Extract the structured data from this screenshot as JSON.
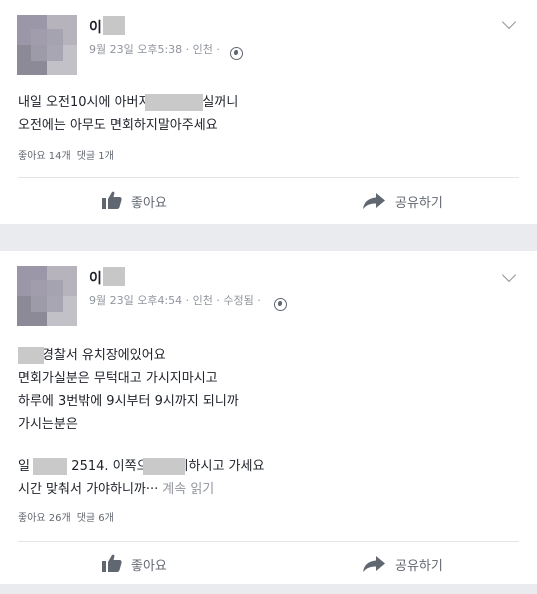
{
  "posts": [
    {
      "author_name": "이",
      "meta": "9월 23일 오후5:38 · 인천 ·",
      "lines": [
        "내일 오전10시에                    아버지가 면회가실꺼니",
        "오전에는 아무도 면회하지말아주세요"
      ],
      "likes": "좋아요 14개",
      "comments": "댓글 1개",
      "like_label": "좋아요",
      "share_label": "공유하기"
    },
    {
      "author_name": "이",
      "meta": "9월 23일 오후4:54 · 인천 · 수정됨 ·",
      "lines": [
        "            삼산경찰서 유치장에있어요",
        "면회가실분은 무턱대고 가시지마시고",
        "하루에 3번밖에 9시부터 9시까지 되니까",
        "가시는분은",
        "",
        "일              010 . 2514.                   이쪽으로 애기하시고 가세요",
        "시간 맞춰서 가야하니까···"
      ],
      "see_more": "계속 읽기",
      "likes": "좋아요 26개",
      "comments": "댓글 6개",
      "like_label": "좋아요",
      "share_label": "공유하기"
    }
  ],
  "icons": [
    "chevron-down-icon",
    "globe-icon",
    "thumbs-up-icon",
    "share-arrow-icon"
  ],
  "colors": {
    "text": "#1d2129",
    "muted": "#90949c",
    "action": "#616770",
    "page_bg": "#e9ebee"
  }
}
